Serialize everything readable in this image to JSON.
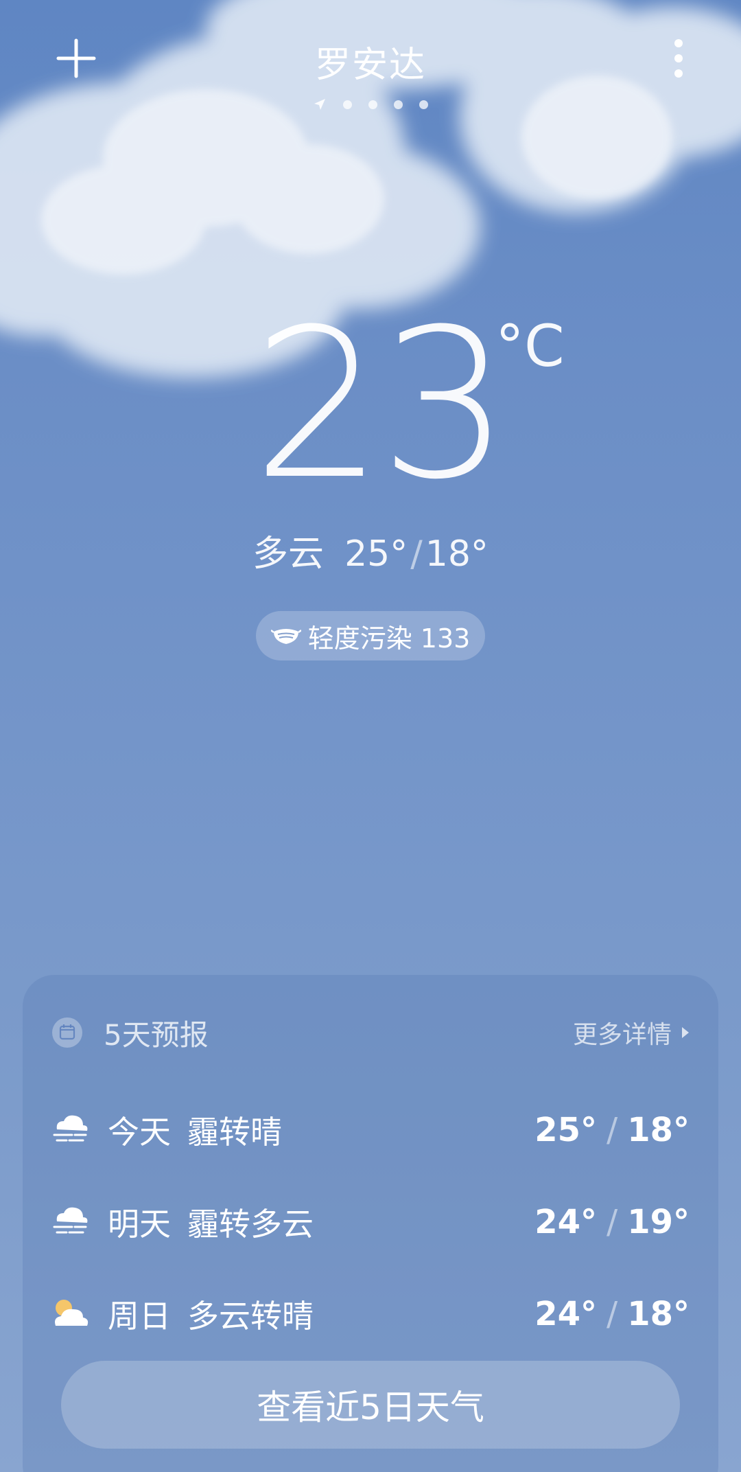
{
  "header": {
    "city": "罗安达",
    "page_count": 5
  },
  "current": {
    "temperature": "23",
    "unit": "°C",
    "condition": "多云",
    "high": "25°",
    "low": "18°",
    "aqi_label": "轻度污染 133"
  },
  "forecast": {
    "title": "5天预报",
    "more_label": "更多详情",
    "days": [
      {
        "day": "今天",
        "condition": "霾转晴",
        "high": "25°",
        "low": "18°",
        "icon": "haze-icon"
      },
      {
        "day": "明天",
        "condition": "霾转多云",
        "high": "24°",
        "low": "19°",
        "icon": "haze-icon"
      },
      {
        "day": "周日",
        "condition": "多云转晴",
        "high": "24°",
        "low": "18°",
        "icon": "partly-cloudy-icon"
      }
    ],
    "button_label": "查看近5日天气"
  },
  "colors": {
    "sky_top": "#5f86c3",
    "sky_bottom": "#89a5d0",
    "sun": "#f5c66a"
  }
}
